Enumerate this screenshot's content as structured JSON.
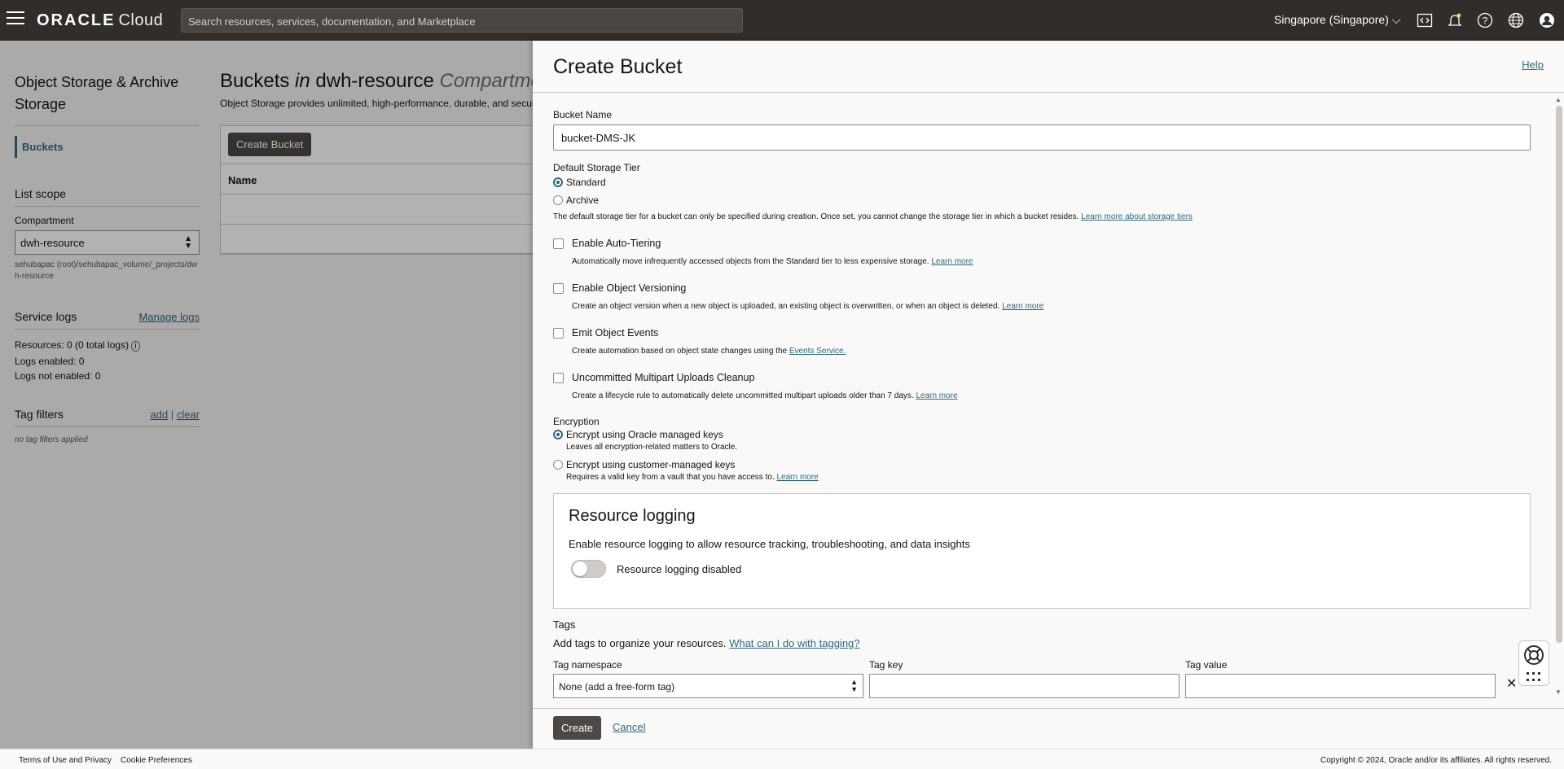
{
  "topbar": {
    "logo_brand": "ORACLE",
    "logo_product": "Cloud",
    "search_placeholder": "Search resources, services, documentation, and Marketplace",
    "region": "Singapore (Singapore)"
  },
  "leftnav": {
    "title": "Object Storage & Archive Storage",
    "active_item": "Buckets",
    "list_scope": "List scope",
    "compartment_label": "Compartment",
    "compartment_value": "dwh-resource",
    "compartment_path": "sehubapac (root)/sehubapac_volume/_projects/dwh-resource",
    "service_logs": "Service logs",
    "manage_logs": "Manage logs",
    "resources": "Resources:  0 (0 total logs)",
    "logs_enabled": "Logs enabled:  0",
    "logs_not_enabled": "Logs not enabled:  0",
    "tag_filters": "Tag filters",
    "tag_add": "add",
    "tag_sep": "|",
    "tag_clear": "clear",
    "no_tags": "no tag filters applied"
  },
  "main": {
    "title_a": "Buckets",
    "title_in": "in",
    "title_b": "dwh-resource",
    "title_c": "Compartment",
    "subtitle": "Object Storage provides unlimited, high-performance, durable, and secure data storage.",
    "create_bucket": "Create Bucket",
    "col_name": "Name"
  },
  "panel": {
    "title": "Create Bucket",
    "help": "Help",
    "bucket_name_label": "Bucket Name",
    "bucket_name_value": "bucket-DMS-JK",
    "storage_tier_label": "Default Storage Tier",
    "tier_standard": "Standard",
    "tier_archive": "Archive",
    "tier_note": "The default storage tier for a bucket can only be specified during creation. Once set, you cannot change the storage tier in which a bucket resides.",
    "tier_note_link": "Learn more about storage tiers",
    "auto_tiering": "Enable Auto-Tiering",
    "auto_tiering_sub": "Automatically move infrequently accessed objects from the Standard tier to less expensive storage.",
    "versioning": "Enable Object Versioning",
    "versioning_sub": "Create an object version when a new object is uploaded, an existing object is overwritten, or when an object is deleted.",
    "events": "Emit Object Events",
    "events_sub": "Create automation based on object state changes using the",
    "events_link": "Events Service.",
    "multipart": "Uncommitted Multipart Uploads Cleanup",
    "multipart_sub": "Create a lifecycle rule to automatically delete uncommitted multipart uploads older than 7 days.",
    "learn_more": "Learn more",
    "encryption_label": "Encryption",
    "enc_oracle": "Encrypt using Oracle managed keys",
    "enc_oracle_sub": "Leaves all encryption-related matters to Oracle.",
    "enc_customer": "Encrypt using customer-managed keys",
    "enc_customer_sub": "Requires a valid key from a vault that you have access to.",
    "logging_title": "Resource logging",
    "logging_desc": "Enable resource logging to allow resource tracking, troubleshooting, and data insights",
    "logging_toggle": "Resource logging disabled",
    "tags_title": "Tags",
    "tags_desc": "Add tags to organize your resources.",
    "tags_link": "What can I do with tagging?",
    "tag_namespace": "Tag namespace",
    "tag_namespace_value": "None (add a free-form tag)",
    "tag_key": "Tag key",
    "tag_value": "Tag value",
    "create": "Create",
    "cancel": "Cancel"
  },
  "footer": {
    "terms": "Terms of Use and Privacy",
    "cookies": "Cookie Preferences",
    "copyright": "Copyright © 2024, Oracle and/or its affiliates. All rights reserved."
  },
  "colors": {
    "topbar": "#312d2a",
    "accent": "#2b6a80",
    "button": "#4c4845"
  }
}
